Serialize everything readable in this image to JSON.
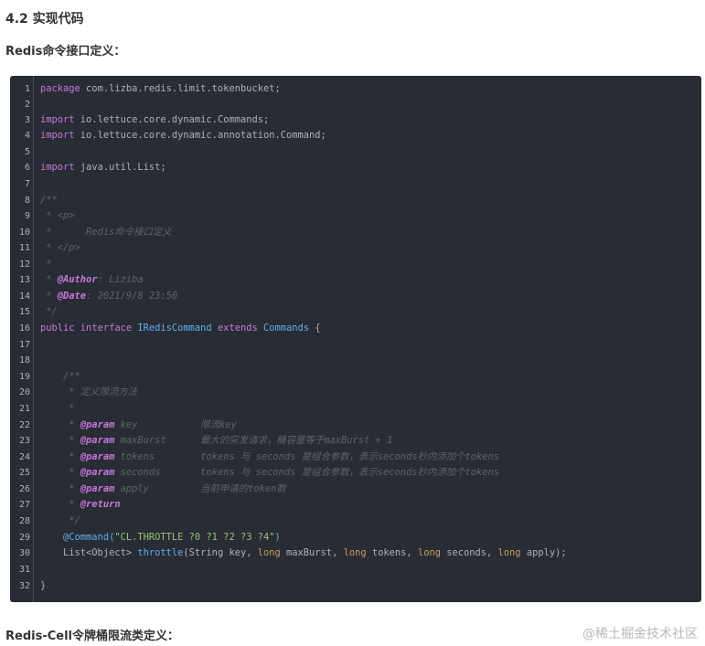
{
  "section_heading": "4.2 实现代码",
  "subheading": "Redis命令接口定义：",
  "footer_heading": "Redis-Cell令牌桶限流类定义：",
  "watermark": "@稀土掘金技术社区",
  "code": {
    "line_numbers": [
      "1",
      "2",
      "3",
      "4",
      "5",
      "6",
      "7",
      "8",
      "9",
      "10",
      "11",
      "12",
      "13",
      "14",
      "15",
      "16",
      "17",
      "18",
      "19",
      "20",
      "21",
      "22",
      "23",
      "24",
      "25",
      "26",
      "27",
      "28",
      "29",
      "30",
      "31",
      "32"
    ],
    "l1_kw": "package",
    "l1_rest": " com.lizba.redis.limit.tokenbucket;",
    "l3_kw": "import",
    "l3_rest": " io.lettuce.core.dynamic.Commands;",
    "l4_kw": "import",
    "l4_rest": " io.lettuce.core.dynamic.annotation.Command;",
    "l6_kw": "import",
    "l6_rest": " java.util.List;",
    "l8": "/**",
    "l9": " * <p>",
    "l10": " *      Redis命令接口定义",
    "l11": " * </p>",
    "l12": " *",
    "l13_pre": " * ",
    "l13_tag": "@Author",
    "l13_rest": ": Liziba",
    "l14_pre": " * ",
    "l14_tag": "@Date",
    "l14_rest": ": 2021/9/8 23:50",
    "l15": " */",
    "l16_public": "public",
    "l16_interface": " interface",
    "l16_name": " IRedisCommand",
    "l16_extends": " extends",
    "l16_parent": " Commands",
    "l16_brace": " {",
    "l19": "    /**",
    "l20": "     * 定义限流方法",
    "l21": "     *",
    "l22_pre": "     * ",
    "l22_tag": "@param",
    "l22_rest": " key           限流key",
    "l23_pre": "     * ",
    "l23_tag": "@param",
    "l23_rest": " maxBurst      最大的突发请求，桶容量等于maxBurst + 1",
    "l24_pre": "     * ",
    "l24_tag": "@param",
    "l24_rest": " tokens        tokens 与 seconds 是组合参数，表示seconds秒内添加个tokens",
    "l25_pre": "     * ",
    "l25_tag": "@param",
    "l25_rest": " seconds       tokens 与 seconds 是组合参数，表示seconds秒内添加个tokens",
    "l26_pre": "     * ",
    "l26_tag": "@param",
    "l26_rest": " apply         当前申请的token数",
    "l27_pre": "     * ",
    "l27_tag": "@return",
    "l28": "     */",
    "l29_ann": "    @Command(",
    "l29_str": "\"CL.THROTTLE ?0 ?1 ?2 ?3 ?4\"",
    "l29_close": ")",
    "l30_a": "    List<Object> ",
    "l30_fn": "throttle",
    "l30_b": "(String key, ",
    "l30_long1": "long",
    "l30_c": " maxBurst, ",
    "l30_long2": "long",
    "l30_d": " tokens, ",
    "l30_long3": "long",
    "l30_e": " seconds, ",
    "l30_long4": "long",
    "l30_f": " apply);",
    "l32": "}"
  }
}
